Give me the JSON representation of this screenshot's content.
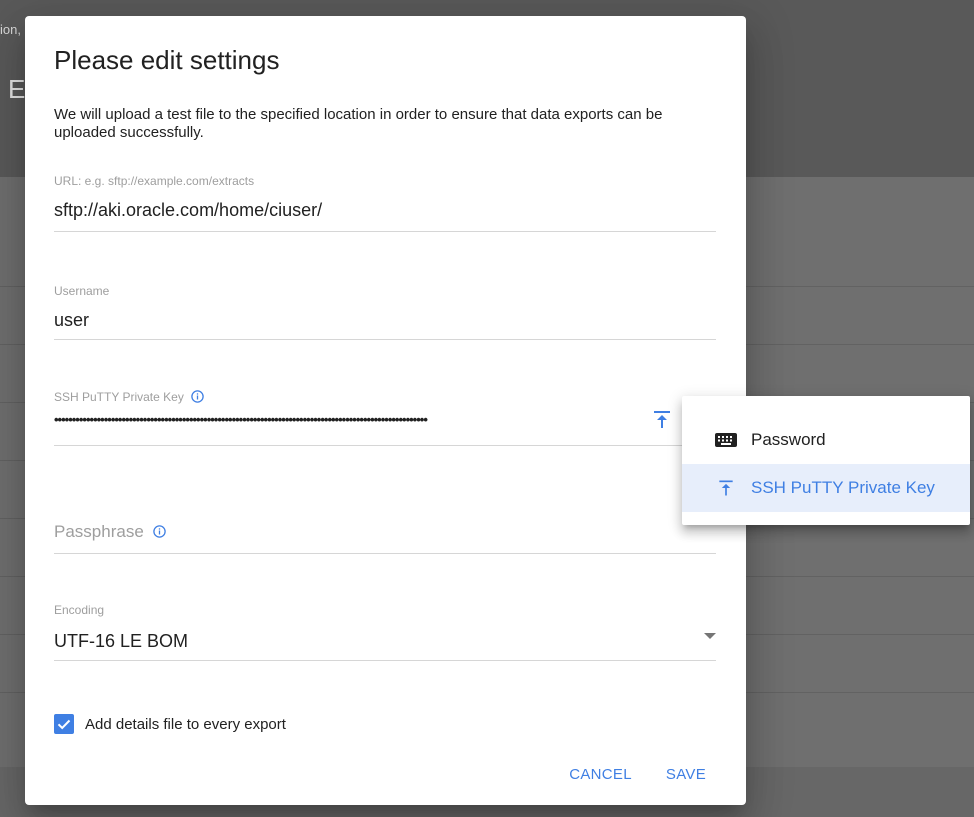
{
  "background": {
    "crumb_fragment": "ion,",
    "heading_fragment": "E"
  },
  "dialog": {
    "title": "Please edit settings",
    "description": "We will upload a test file to the specified location in order to ensure that data exports can be uploaded successfully.",
    "url_field": {
      "label": "URL: e.g. sftp://example.com/extracts",
      "value": "sftp://aki.oracle.com/home/ciuser/"
    },
    "username_field": {
      "label": "Username",
      "value": "user"
    },
    "private_key_field": {
      "label": "SSH PuTTY Private Key",
      "value": "•••••••••••••••••••••••••••••••••••••••••••••••••••••••••••••••••••••••••••••••••••••••••••••••••••••••••"
    },
    "passphrase_field": {
      "label": "Passphrase"
    },
    "encoding_field": {
      "label": "Encoding",
      "value": "UTF-16 LE BOM"
    },
    "details_checkbox": {
      "label": "Add details file to every export",
      "checked": true
    },
    "actions": {
      "cancel_label": "CANCEL",
      "save_label": "SAVE"
    }
  },
  "auth_menu": {
    "items": [
      {
        "label": "Password",
        "icon": "keyboard-icon",
        "selected": false
      },
      {
        "label": "SSH PuTTY Private Key",
        "icon": "upload-icon",
        "selected": true
      }
    ]
  },
  "colors": {
    "accent": "#3f7fe3",
    "selected_item_bg": "#e7eefb",
    "label_gray": "#9e9e9e",
    "backdrop": "#6b6b6b"
  }
}
